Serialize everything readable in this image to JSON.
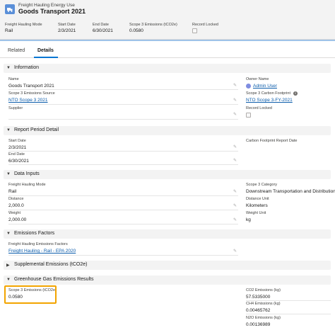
{
  "header": {
    "object_type": "Freight Hauling Energy Use",
    "title": "Goods Transport 2021",
    "highlights": [
      {
        "label": "Freight Hauling Mode",
        "value": "Rail"
      },
      {
        "label": "Start Date",
        "value": "2/3/2021"
      },
      {
        "label": "End Date",
        "value": "6/30/2021"
      },
      {
        "label": "Scope 3 Emissions (tCO2e)",
        "value": "0.0580"
      },
      {
        "label": "Record Locked",
        "value": ""
      }
    ]
  },
  "tabs": [
    "Related",
    "Details"
  ],
  "sections": {
    "information": {
      "title": "Information",
      "name_label": "Name",
      "name_value": "Goods Transport 2021",
      "source_label": "Scope 3 Emissions Source",
      "source_value": "NTO Scope 3 2021",
      "supplier_label": "Supplier",
      "supplier_value": "",
      "owner_label": "Owner Name",
      "owner_value": "Admin User",
      "footprint_label": "Scope 3 Carbon Footprint",
      "footprint_value": "NTO Scope 3-FY-2021",
      "locked_label": "Record Locked"
    },
    "report_period": {
      "title": "Report Period Detail",
      "start_label": "Start Date",
      "start_value": "2/3/2021",
      "end_label": "End Date",
      "end_value": "6/30/2021",
      "cf_report_label": "Carbon Footprint Report Date",
      "cf_report_value": ""
    },
    "data_inputs": {
      "title": "Data Inputs",
      "mode_label": "Freight Hauling Mode",
      "mode_value": "Rail",
      "distance_label": "Distance",
      "distance_value": "2,000.0",
      "weight_label": "Weight",
      "weight_value": "2,000.00",
      "category_label": "Scope 3 Category",
      "category_value": "Downstream Transportation and Distribution",
      "dist_unit_label": "Distance Unit",
      "dist_unit_value": "Kilometers",
      "weight_unit_label": "Weight Unit",
      "weight_unit_value": "kg"
    },
    "emissions_factors": {
      "title": "Emissions Factors",
      "factors_label": "Freight Hauling Emissions Factors",
      "factors_value": "Freight Hauling - Rail - EPA 2020"
    },
    "supplemental": {
      "title": "Supplemental Emissions (tCO2e)"
    },
    "ghg": {
      "title": "Greenhouse Gas Emissions Results",
      "scope3_label": "Scope 3 Emissions (tCO2e)",
      "scope3_value": "0.0580",
      "co2_label": "CO2 Emissions (kg)",
      "co2_value": "57.5335000",
      "ch4_label": "CH4 Emissions (kg)",
      "ch4_value": "0.00465762",
      "n2o_label": "N2O Emissions (kg)",
      "n2o_value": "0.00136989"
    }
  }
}
